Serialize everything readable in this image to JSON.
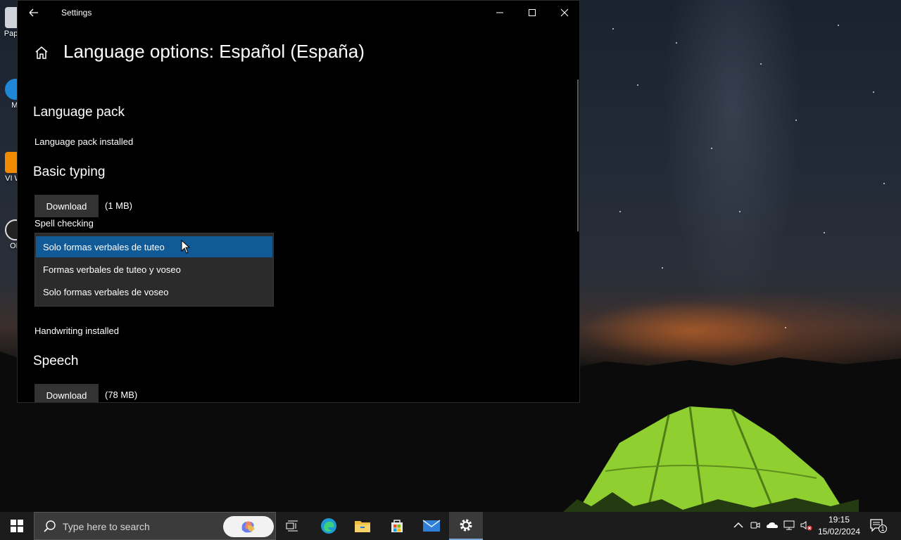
{
  "window": {
    "title": "Settings",
    "page_title": "Language options: Español (España)"
  },
  "sections": {
    "language_pack": {
      "heading": "Language pack",
      "status": "Language pack installed"
    },
    "basic_typing": {
      "heading": "Basic typing",
      "download_label": "Download",
      "size": "(1 MB)",
      "spell_checking_label": "Spell checking"
    },
    "handwriting": {
      "status": "Handwriting installed"
    },
    "speech": {
      "heading": "Speech",
      "download_label": "Download",
      "size": "(78 MB)"
    }
  },
  "dropdown": {
    "options": [
      "Solo formas verbales de tuteo",
      "Formas verbales de tuteo y voseo",
      "Solo formas verbales de voseo"
    ],
    "selected_index": 0
  },
  "desktop_icons": [
    {
      "label": "Pap re"
    },
    {
      "label": "Mi"
    },
    {
      "label": "VI Wo"
    },
    {
      "label": "OB"
    }
  ],
  "taskbar": {
    "search_placeholder": "Type here to search",
    "apps": [
      "task-view-icon",
      "edge-icon",
      "file-explorer-icon",
      "microsoft-store-icon",
      "mail-icon",
      "settings-icon"
    ],
    "active_app": "settings-icon",
    "time": "19:15",
    "date": "15/02/2024",
    "notification_count": "1"
  },
  "colors": {
    "selection": "#0f5a97",
    "window_bg": "#000000",
    "taskbar_bg": "#1c1c1c",
    "tent_green": "#9fd93a"
  }
}
